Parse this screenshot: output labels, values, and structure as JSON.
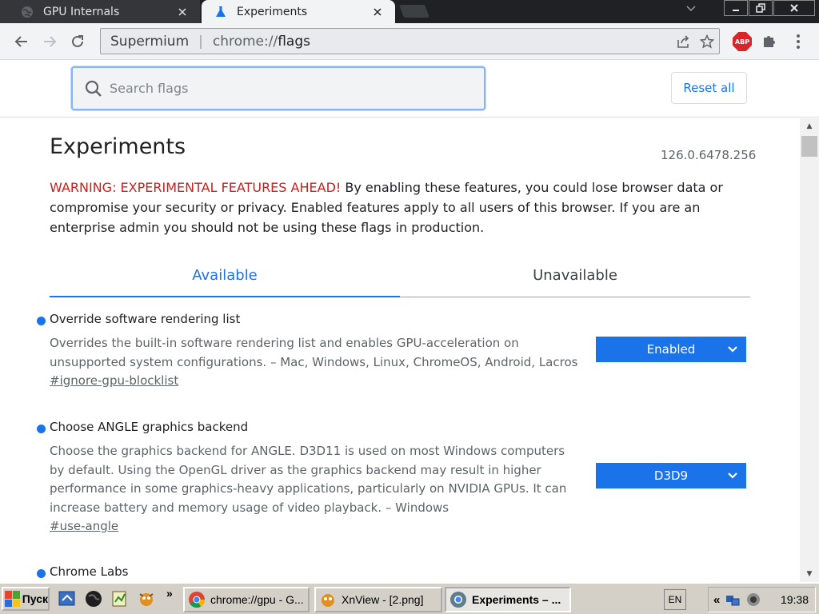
{
  "tabstrip": {
    "tabs": [
      {
        "title": "GPU Internals",
        "active": false
      },
      {
        "title": "Experiments",
        "active": true
      }
    ],
    "window_controls": [
      "minimize",
      "restore",
      "close"
    ]
  },
  "toolbar": {
    "origin": "Supermium",
    "url_scheme": "chrome://",
    "url_path": "flags",
    "abp_label": "ABP"
  },
  "search": {
    "placeholder": "Search flags",
    "value": "",
    "reset_label": "Reset all"
  },
  "page": {
    "title": "Experiments",
    "version": "126.0.6478.256",
    "warning_prefix": "WARNING: EXPERIMENTAL FEATURES AHEAD!",
    "warning_text": " By enabling these features, you could lose browser data or compromise your security or privacy. Enabled features apply to all users of this browser. If you are an enterprise admin you should not be using these flags in production.",
    "tabs": [
      {
        "label": "Available",
        "selected": true
      },
      {
        "label": "Unavailable",
        "selected": false
      }
    ]
  },
  "flags": [
    {
      "title": "Override software rendering list",
      "description": "Overrides the built-in software rendering list and enables GPU-acceleration on unsupported system configurations. – Mac, Windows, Linux, ChromeOS, Android, Lacros",
      "link": "#ignore-gpu-blocklist",
      "selected": "Enabled"
    },
    {
      "title": "Choose ANGLE graphics backend",
      "description": "Choose the graphics backend for ANGLE. D3D11 is used on most Windows computers by default. Using the OpenGL driver as the graphics backend may result in higher performance in some graphics-heavy applications, particularly on NVIDIA GPUs. It can increase battery and memory usage of video playback. – Windows",
      "link": "#use-angle",
      "selected": "D3D9"
    },
    {
      "title": "Chrome Labs"
    }
  ],
  "taskbar": {
    "start_label": "Пуск",
    "more_label": "»",
    "tasks": [
      {
        "label": "chrome://gpu - G...",
        "active": false
      },
      {
        "label": "XnView - [2.png]",
        "active": false
      },
      {
        "label": "Experiments – ...",
        "active": true
      }
    ],
    "language": "EN",
    "tray_arrows": "«",
    "clock": "19:38"
  },
  "colors": {
    "accent": "#1a73e8",
    "warning": "#c5221f",
    "tabstrip_bg": "#202124",
    "toolbar_bg": "#f1f3f4"
  }
}
